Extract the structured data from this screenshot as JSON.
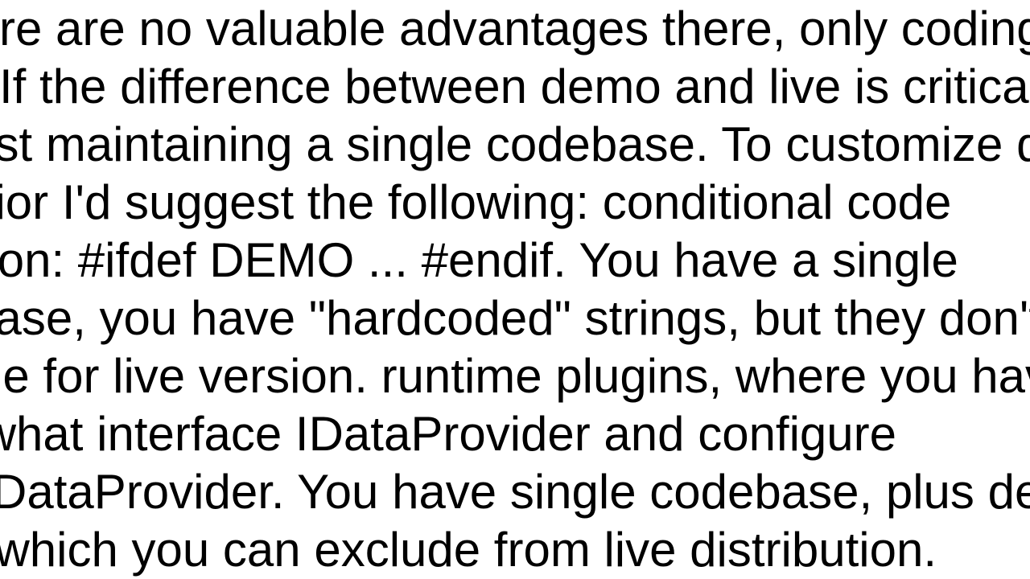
{
  "document": {
    "body_text": "1: There are no valuable advantages there, only coding effort. If the difference between demo and live is critical, I'd suggest maintaining a single codebase. To customize demo behavior I'd suggest the following: conditional code inclusion: #ifdef DEMO ... #endif. You have a single codebase, you have \"hardcoded\" strings, but they don't compile for live version. runtime plugins, where you have somewhat interface IDataProvider and configure DemoDataProvider. You have single codebase, plus demo code, which you can exclude from live distribution."
  }
}
